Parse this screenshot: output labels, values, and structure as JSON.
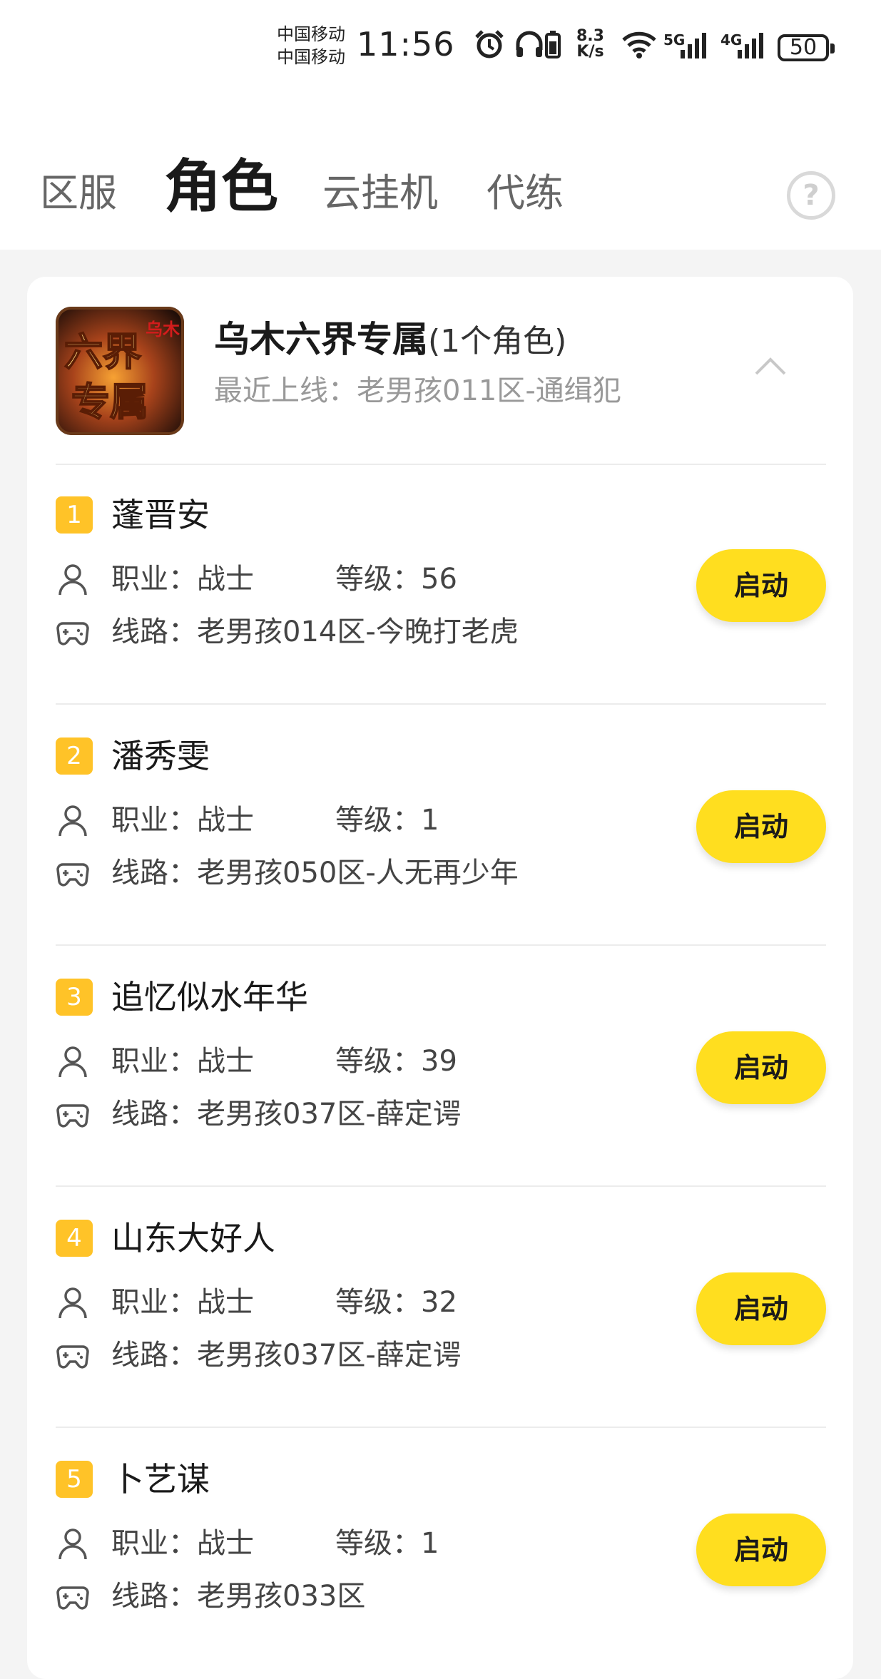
{
  "status_bar": {
    "carrier_1": "中国移动",
    "carrier_2": "中国移动",
    "time": "11:56",
    "net_speed_value": "8.3",
    "net_speed_unit": "K/s",
    "gen_1": "5G",
    "gen_2": "4G",
    "battery": "50"
  },
  "tabs": [
    {
      "label": "区服",
      "active": false
    },
    {
      "label": "角色",
      "active": true
    },
    {
      "label": "云挂机",
      "active": false
    },
    {
      "label": "代练",
      "active": false
    }
  ],
  "help_label": "?",
  "game": {
    "title": "乌木六界专属",
    "count": "(1个角色)",
    "last_online_label": "最近上线：",
    "last_online_value": "老男孩011区-通缉犯",
    "icon_text_main": "六界专属",
    "icon_text_seal": "乌木"
  },
  "labels": {
    "job": "职业：",
    "level": "等级：",
    "route": "线路：",
    "launch": "启动"
  },
  "roles": [
    {
      "index": "1",
      "name": "蓬晋安",
      "job": "战士",
      "level": "56",
      "route": "老男孩014区-今晚打老虎"
    },
    {
      "index": "2",
      "name": "潘秀雯",
      "job": "战士",
      "level": "1",
      "route": "老男孩050区-人无再少年"
    },
    {
      "index": "3",
      "name": "追忆似水年华",
      "job": "战士",
      "level": "39",
      "route": "老男孩037区-薛定谔"
    },
    {
      "index": "4",
      "name": "山东大好人",
      "job": "战士",
      "level": "32",
      "route": "老男孩037区-薛定谔"
    },
    {
      "index": "5",
      "name": "卜艺谋",
      "job": "战士",
      "level": "1",
      "route": "老男孩033区"
    }
  ],
  "colors": {
    "accent": "#ffde1f",
    "badge": "#ffc328",
    "background": "#f4f4f4"
  }
}
